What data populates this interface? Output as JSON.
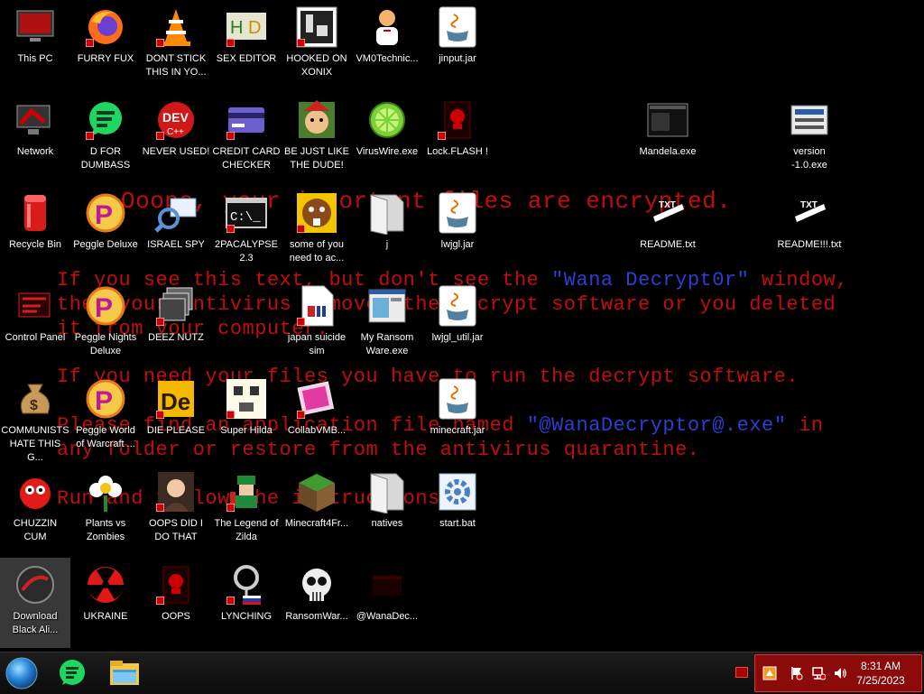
{
  "ransom": {
    "title": "Ooops, your important files are encrypted.",
    "line1a": "If you see this text, but don't see the ",
    "line1b": "\"Wana Decrypt0r\"",
    "line1c": " window,",
    "line2": "then your antivirus removed the decrypt software or you deleted",
    "line3": "it from your computer.",
    "line4": "If you need your files you have to run the decrypt software.",
    "line5a": "Please find an application file named ",
    "line5b": "\"@WanaDecryptor@.exe\"",
    "line5c": " in",
    "line6": "any folder or restore from the antivirus quarantine.",
    "line7": "Run and follow the instructions!"
  },
  "icons": [
    {
      "label": "This PC",
      "icon": "monitor-icon"
    },
    {
      "label": "FURRY FUX",
      "icon": "firefox-icon"
    },
    {
      "label": "DONT STICK THIS IN YO...",
      "icon": "vlc-cone-icon"
    },
    {
      "label": "SEX EDITOR",
      "icon": "hex-editor-icon"
    },
    {
      "label": "HOOKED ON XONIX",
      "icon": "xonix-game-icon"
    },
    {
      "label": "VM0Technic...",
      "icon": "doctor-person-icon"
    },
    {
      "label": "jinput.jar",
      "icon": "java-jar-icon"
    },
    {
      "label": "Network",
      "icon": "network-icon"
    },
    {
      "label": "D FOR DUMBASS",
      "icon": "chat-bubble-icon"
    },
    {
      "label": "NEVER USED!",
      "icon": "dev-cpp-icon"
    },
    {
      "label": "CREDIT CARD CHECKER",
      "icon": "credit-card-icon"
    },
    {
      "label": "BE JUST LIKE THE DUDE!",
      "icon": "elf-face-icon"
    },
    {
      "label": "VirusWire.exe",
      "icon": "lime-icon"
    },
    {
      "label": "Lock.FLASH !",
      "icon": "red-skull-app-icon"
    },
    {
      "label": "Mandela.exe",
      "icon": "black-window-icon"
    },
    {
      "label": "version -1.0.exe",
      "icon": "installer-icon"
    },
    {
      "label": "Recycle Bin",
      "icon": "recycle-bin-icon"
    },
    {
      "label": "Peggle Deluxe",
      "icon": "peggle-icon"
    },
    {
      "label": "ISRAEL SPY",
      "icon": "spy-magnifier-icon"
    },
    {
      "label": "2PACALYPSE 2.3",
      "icon": "terminal-icon"
    },
    {
      "label": "some of you need to ac...",
      "icon": "beaver-icon"
    },
    {
      "label": "j",
      "icon": "folder-icon"
    },
    {
      "label": "lwjgl.jar",
      "icon": "java-jar-icon"
    },
    {
      "label": "README.txt",
      "icon": "txt-file-icon"
    },
    {
      "label": "README!!!.txt",
      "icon": "txt-file-icon"
    },
    {
      "label": "Control Panel",
      "icon": "control-panel-icon"
    },
    {
      "label": "Peggle Nights Deluxe",
      "icon": "peggle-icon"
    },
    {
      "label": "DEEZ NUTZ",
      "icon": "stacked-windows-icon"
    },
    {
      "label": "japan suicide sim",
      "icon": "file-icon"
    },
    {
      "label": "My Ransom Ware.exe",
      "icon": "app-window-icon"
    },
    {
      "label": "lwjgl_util.jar",
      "icon": "java-jar-icon"
    },
    {
      "label": "COMMUNISTS HATE THIS G...",
      "icon": "money-bag-icon"
    },
    {
      "label": "Peggle World of Warcraft ...",
      "icon": "peggle-icon"
    },
    {
      "label": "DIE PLEASE",
      "icon": "de-letters-icon"
    },
    {
      "label": "Super Hilda",
      "icon": "pixel-game-icon"
    },
    {
      "label": "CollabVMB...",
      "icon": "glass-box-icon"
    },
    {
      "label": "minecraft.jar",
      "icon": "java-jar-icon"
    },
    {
      "label": "CHUZZIN CUM",
      "icon": "chuzzle-icon"
    },
    {
      "label": "Plants vs Zombies",
      "icon": "flower-icon"
    },
    {
      "label": "OOPS DID I DO THAT",
      "icon": "portrait-icon"
    },
    {
      "label": "The Legend of Zilda",
      "icon": "pixel-hero-icon"
    },
    {
      "label": "Minecraft4Fr...",
      "icon": "grass-block-icon"
    },
    {
      "label": "natives",
      "icon": "folder-icon"
    },
    {
      "label": "start.bat",
      "icon": "batch-gear-icon"
    },
    {
      "label": "Download Black Ali...",
      "icon": "dark-orb-icon"
    },
    {
      "label": "UKRAINE",
      "icon": "radiation-icon"
    },
    {
      "label": "OOPS",
      "icon": "red-skull-app-icon"
    },
    {
      "label": "LYNCHING",
      "icon": "lynching-icon"
    },
    {
      "label": "RansomWar...",
      "icon": "skull-icon"
    },
    {
      "label": "@WanaDec...",
      "icon": "wana-decryptor-icon"
    }
  ],
  "taskbar": {
    "start": "start-orb-icon",
    "pinned": [
      "chat-bubble-icon",
      "file-explorer-icon"
    ],
    "time": "8:31 AM",
    "date": "7/25/2023"
  }
}
